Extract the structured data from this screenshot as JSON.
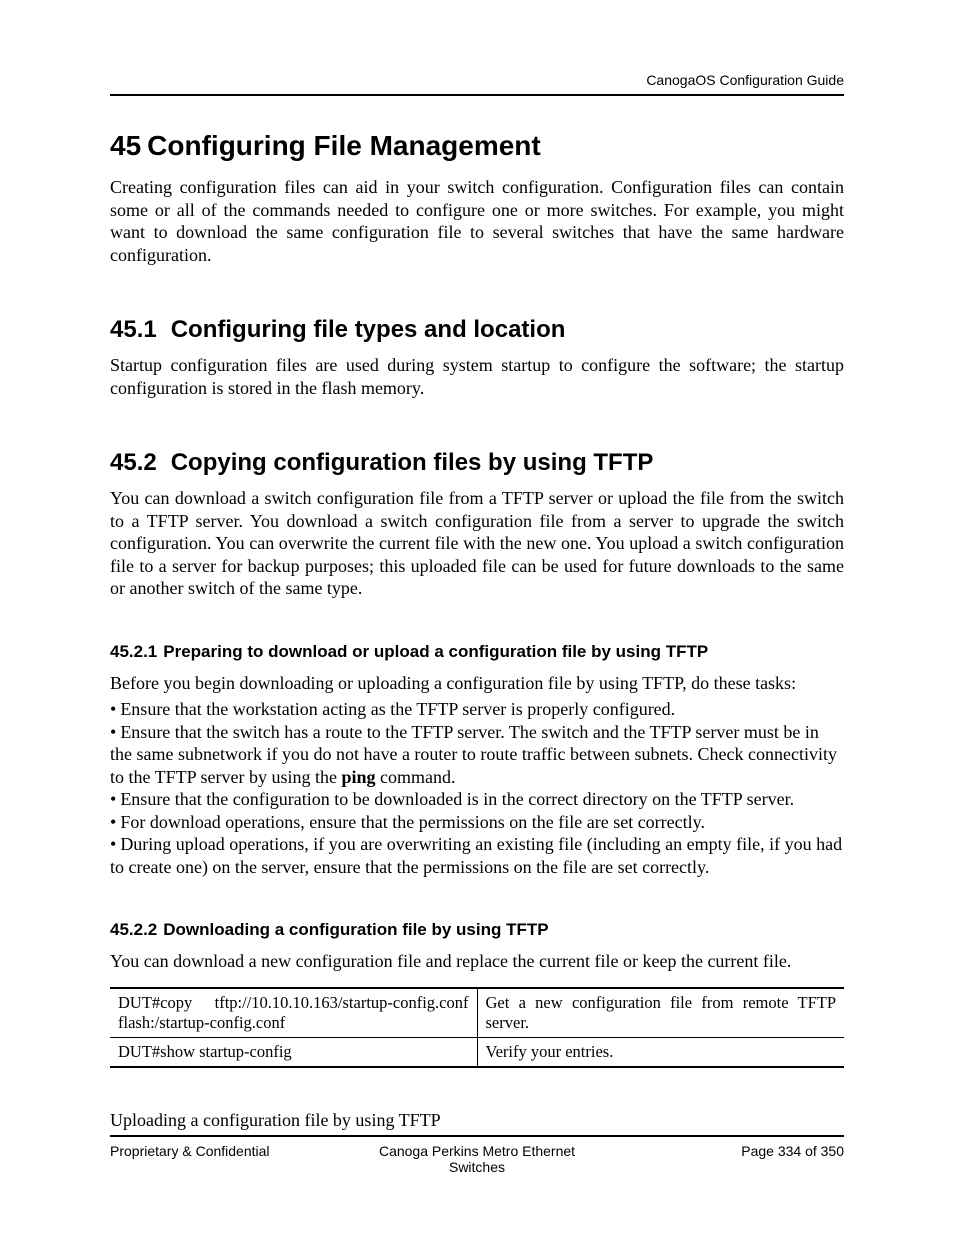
{
  "header": {
    "running_head": "CanogaOS Configuration Guide"
  },
  "chapter": {
    "number": "45",
    "title": "Configuring File Management",
    "intro": "Creating configuration files can aid in your switch configuration. Configuration files can contain some or all of the commands needed to configure one or more switches. For example, you might want to download the same configuration file to several switches that have the same hardware configuration."
  },
  "sections": {
    "s451": {
      "number": "45.1",
      "title": "Configuring file types and location",
      "body": "Startup configuration files are used during system startup to configure the software; the startup configuration is stored in the flash memory."
    },
    "s452": {
      "number": "45.2",
      "title": "Copying configuration files by using TFTP",
      "body": "You can download a switch configuration file from a TFTP server or upload the file from the switch to a TFTP server. You download a switch configuration file from a server to upgrade the switch configuration. You can overwrite the current file with the new one. You upload a switch configuration file to a server for backup purposes; this uploaded file can be used for future downloads to the same or another switch of the same type."
    },
    "s4521": {
      "number": "45.2.1",
      "title": "Preparing to download or upload a configuration file by using TFTP",
      "lead": "Before you begin downloading or uploading a configuration file by using TFTP, do these tasks:",
      "bullets": [
        "Ensure that the workstation acting as the TFTP server is properly configured.",
        "Ensure that the switch has a route to the TFTP server. The switch and the TFTP server must be in the same subnetwork if you do not have a router to route traffic between subnets. Check connectivity to the TFTP server by using the ",
        "Ensure that the configuration to be downloaded is in the correct directory on the TFTP server.",
        "For download operations, ensure that the permissions on the file are set correctly.",
        "During upload operations, if you are overwriting an existing file (including an empty file, if you had to create one) on the server, ensure that the permissions on the file are set correctly."
      ],
      "ping_cmd": "ping",
      "ping_tail": " command."
    },
    "s4522": {
      "number": "45.2.2",
      "title": "Downloading a configuration file by using TFTP",
      "body": "You can download a new configuration file and replace the current file or keep the current file.",
      "table": [
        {
          "cmd_a": "DUT#copy",
          "cmd_b": "tftp://10.10.10.163/startup-config.conf",
          "cmd_c": "flash:/startup-config.conf",
          "desc": "Get a new configuration file from remote TFTP server."
        },
        {
          "cmd_a": "DUT#show startup-config",
          "cmd_b": "",
          "cmd_c": "",
          "desc": "Verify your entries."
        }
      ],
      "after": "Uploading a configuration file by using TFTP"
    }
  },
  "footer": {
    "left": "Proprietary & Confidential",
    "center": "Canoga Perkins Metro Ethernet Switches",
    "right": "Page 334 of 350"
  }
}
